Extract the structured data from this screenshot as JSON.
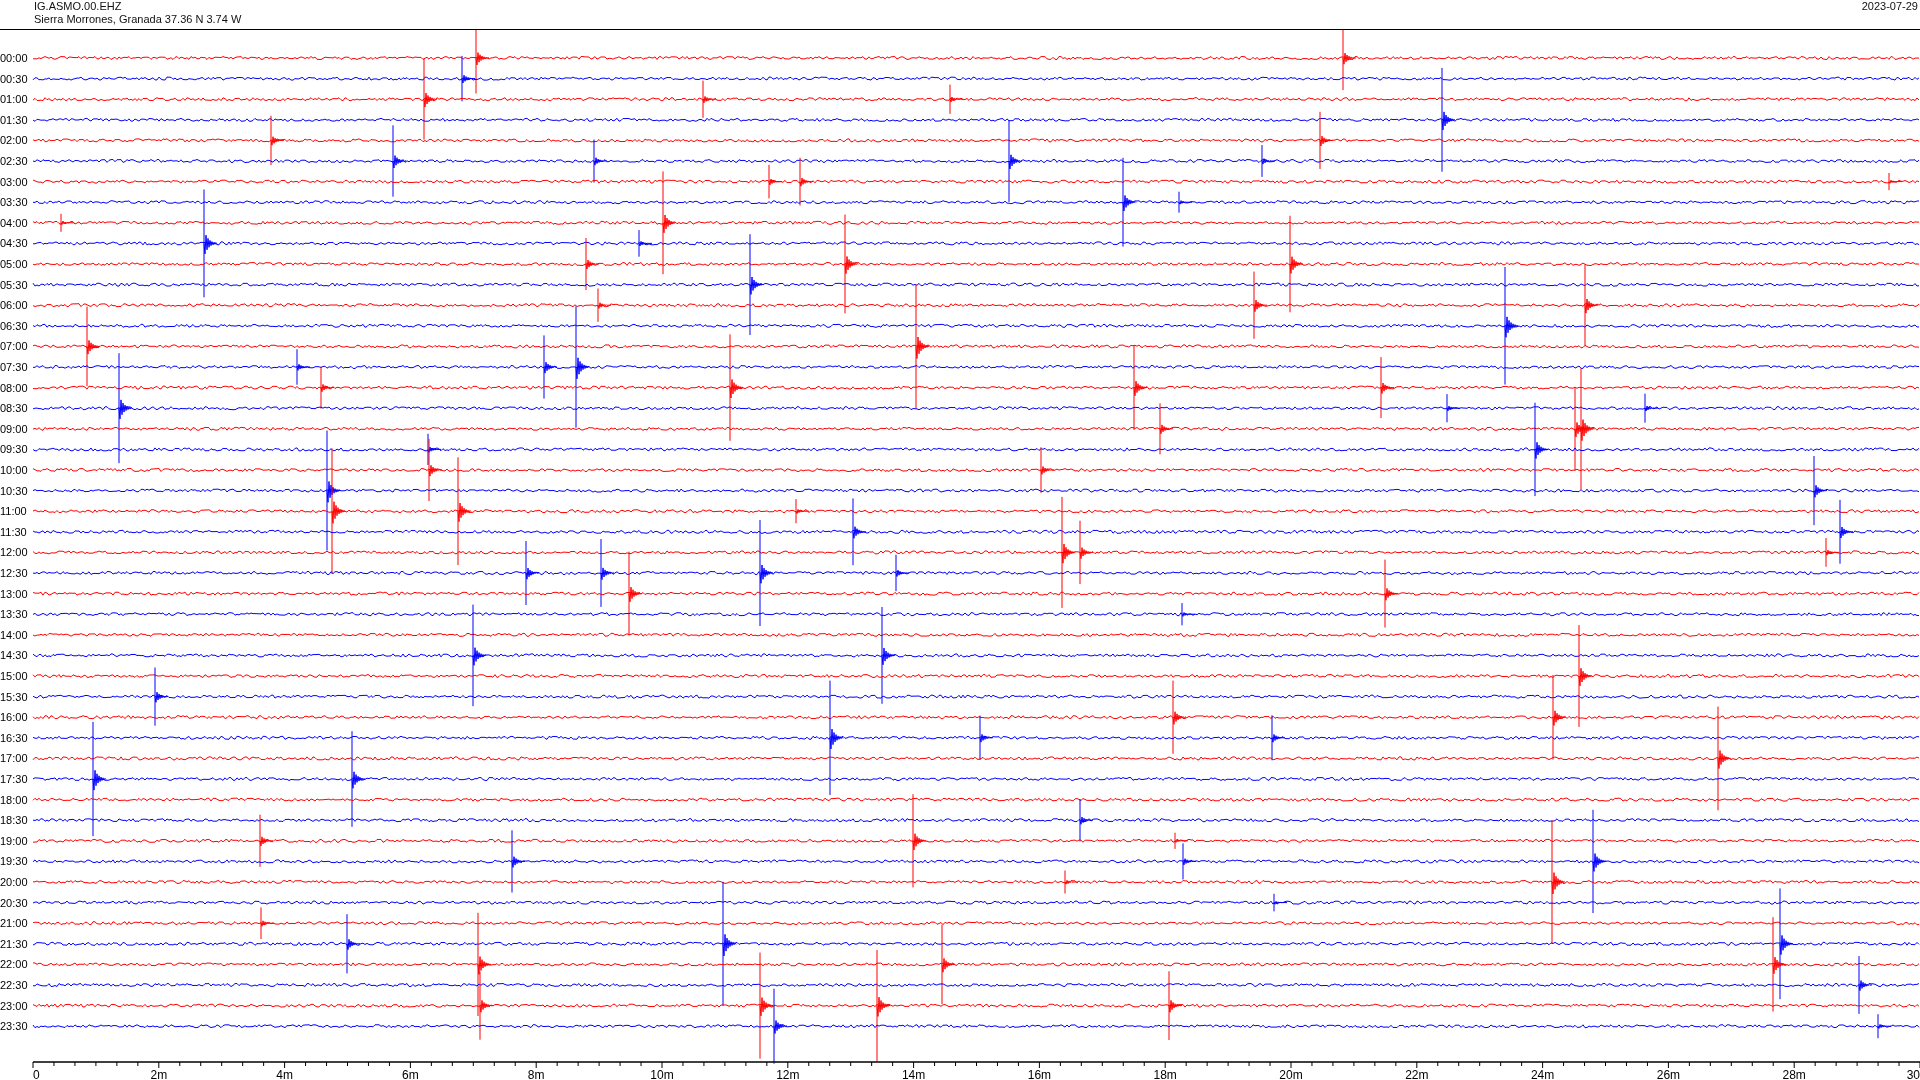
{
  "header": {
    "station": "IG.ASMO.00.EHZ",
    "location": "Sierra Morrones, Granada  37.36 N 3.74 W",
    "date": "2023-07-29"
  },
  "rows": [
    {
      "time": "00:00",
      "color": "#ff0000"
    },
    {
      "time": "00:30",
      "color": "#0000ff"
    },
    {
      "time": "01:00",
      "color": "#ff0000"
    },
    {
      "time": "01:30",
      "color": "#0000ff"
    },
    {
      "time": "02:00",
      "color": "#ff0000"
    },
    {
      "time": "02:30",
      "color": "#0000ff"
    },
    {
      "time": "03:00",
      "color": "#ff0000"
    },
    {
      "time": "03:30",
      "color": "#0000ff"
    },
    {
      "time": "04:00",
      "color": "#ff0000"
    },
    {
      "time": "04:30",
      "color": "#0000ff"
    },
    {
      "time": "05:00",
      "color": "#ff0000"
    },
    {
      "time": "05:30",
      "color": "#0000ff"
    },
    {
      "time": "06:00",
      "color": "#ff0000"
    },
    {
      "time": "06:30",
      "color": "#0000ff"
    },
    {
      "time": "07:00",
      "color": "#ff0000"
    },
    {
      "time": "07:30",
      "color": "#0000ff"
    },
    {
      "time": "08:00",
      "color": "#ff0000"
    },
    {
      "time": "08:30",
      "color": "#0000ff"
    },
    {
      "time": "09:00",
      "color": "#ff0000"
    },
    {
      "time": "09:30",
      "color": "#0000ff"
    },
    {
      "time": "10:00",
      "color": "#ff0000"
    },
    {
      "time": "10:30",
      "color": "#0000ff"
    },
    {
      "time": "11:00",
      "color": "#ff0000"
    },
    {
      "time": "11:30",
      "color": "#0000ff"
    },
    {
      "time": "12:00",
      "color": "#ff0000"
    },
    {
      "time": "12:30",
      "color": "#0000ff"
    },
    {
      "time": "13:00",
      "color": "#ff0000"
    },
    {
      "time": "13:30",
      "color": "#0000ff"
    },
    {
      "time": "14:00",
      "color": "#ff0000"
    },
    {
      "time": "14:30",
      "color": "#0000ff"
    },
    {
      "time": "15:00",
      "color": "#ff0000"
    },
    {
      "time": "15:30",
      "color": "#0000ff"
    },
    {
      "time": "16:00",
      "color": "#ff0000"
    },
    {
      "time": "16:30",
      "color": "#0000ff"
    },
    {
      "time": "17:00",
      "color": "#ff0000"
    },
    {
      "time": "17:30",
      "color": "#0000ff"
    },
    {
      "time": "18:00",
      "color": "#ff0000"
    },
    {
      "time": "18:30",
      "color": "#0000ff"
    },
    {
      "time": "19:00",
      "color": "#ff0000"
    },
    {
      "time": "19:30",
      "color": "#0000ff"
    },
    {
      "time": "20:00",
      "color": "#ff0000"
    },
    {
      "time": "20:30",
      "color": "#0000ff"
    },
    {
      "time": "21:00",
      "color": "#ff0000"
    },
    {
      "time": "21:30",
      "color": "#0000ff"
    },
    {
      "time": "22:00",
      "color": "#ff0000"
    },
    {
      "time": "22:30",
      "color": "#0000ff"
    },
    {
      "time": "23:00",
      "color": "#ff0000"
    },
    {
      "time": "23:30",
      "color": "#0000ff"
    }
  ],
  "x_axis": {
    "ticks": [
      "0",
      "2m",
      "4m",
      "6m",
      "8m",
      "10m",
      "12m",
      "14m",
      "16m",
      "18m",
      "20m",
      "22m",
      "24m",
      "26m",
      "28m",
      "30"
    ]
  }
}
